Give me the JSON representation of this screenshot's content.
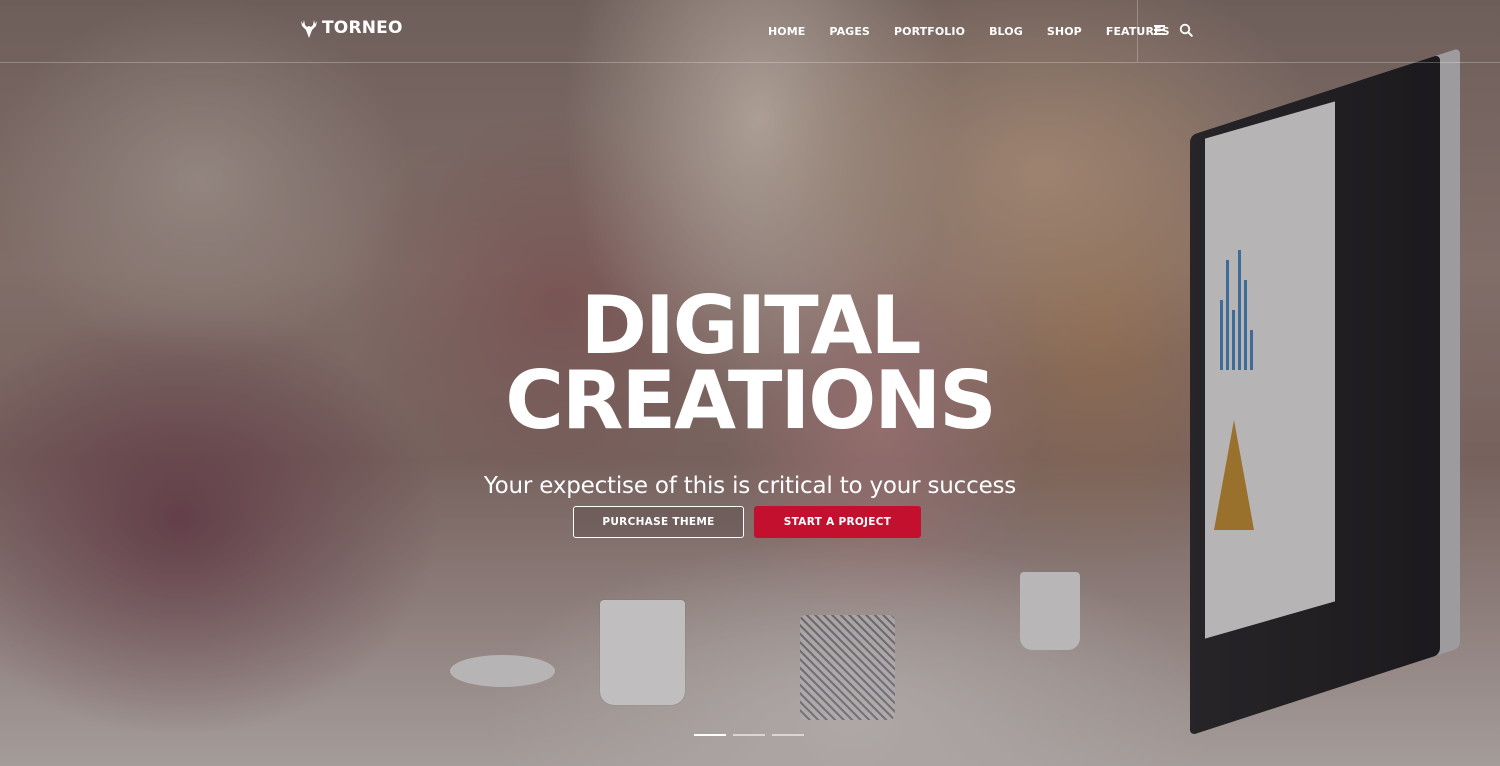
{
  "brand": {
    "logo_icon": "deer-antler-icon",
    "name": "TORNEO"
  },
  "nav": {
    "items": [
      {
        "label": "HOME"
      },
      {
        "label": "PAGES"
      },
      {
        "label": "PORTFOLIO"
      },
      {
        "label": "BLOG"
      },
      {
        "label": "SHOP"
      },
      {
        "label": "FEATURES"
      }
    ],
    "menu_icon": "hamburger-menu-icon",
    "search_icon": "search-icon"
  },
  "hero": {
    "title_line1": "DIGITAL",
    "title_line2": "CREATIONS",
    "subtitle": "Your expectise of this is critical to your success",
    "primary_button": "PURCHASE THEME",
    "secondary_button": "START A PROJECT",
    "slides_total": 3,
    "active_slide": 1
  },
  "colors": {
    "accent": "#c4102f",
    "text": "#ffffff"
  }
}
